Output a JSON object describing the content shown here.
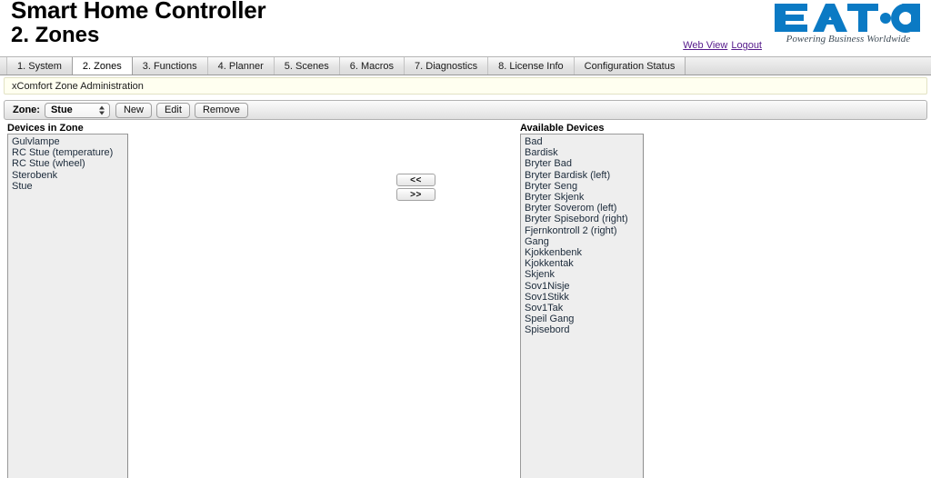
{
  "header": {
    "app_title": "Smart Home Controller",
    "page_title": "2. Zones",
    "links": {
      "web_view": "Web View",
      "logout": "Logout"
    },
    "logo": {
      "brand": "EATON",
      "tagline": "Powering Business Worldwide",
      "color": "#0b7ac4"
    }
  },
  "tabs": [
    {
      "label": "1. System",
      "active": false
    },
    {
      "label": "2. Zones",
      "active": true
    },
    {
      "label": "3. Functions",
      "active": false
    },
    {
      "label": "4. Planner",
      "active": false
    },
    {
      "label": "5. Scenes",
      "active": false
    },
    {
      "label": "6. Macros",
      "active": false
    },
    {
      "label": "7. Diagnostics",
      "active": false
    },
    {
      "label": "8. License Info",
      "active": false
    },
    {
      "label": "Configuration Status",
      "active": false
    }
  ],
  "infobar": {
    "text": "xComfort Zone Administration"
  },
  "toolbar": {
    "zone_label": "Zone:",
    "zone_value": "Stue",
    "new_label": "New",
    "edit_label": "Edit",
    "remove_label": "Remove"
  },
  "panels": {
    "devices_in_zone": {
      "heading": "Devices in Zone",
      "items": [
        "Gulvlampe",
        "RC Stue (temperature)",
        "RC Stue (wheel)",
        "Sterobenk",
        "Stue"
      ]
    },
    "available_devices": {
      "heading": "Available Devices",
      "items": [
        "Bad",
        "Bardisk",
        "Bryter Bad",
        "Bryter Bardisk (left)",
        "Bryter Seng",
        "Bryter Skjenk",
        "Bryter Soverom (left)",
        "Bryter Spisebord (right)",
        "Fjernkontroll 2 (right)",
        "Gang",
        "Kjokkenbenk",
        "Kjokkentak",
        "Skjenk",
        "Sov1Nisje",
        "Sov1Stikk",
        "Sov1Tak",
        "Speil Gang",
        "Spisebord"
      ]
    }
  },
  "transfer": {
    "move_left_label": "<<",
    "move_right_label": ">>"
  }
}
